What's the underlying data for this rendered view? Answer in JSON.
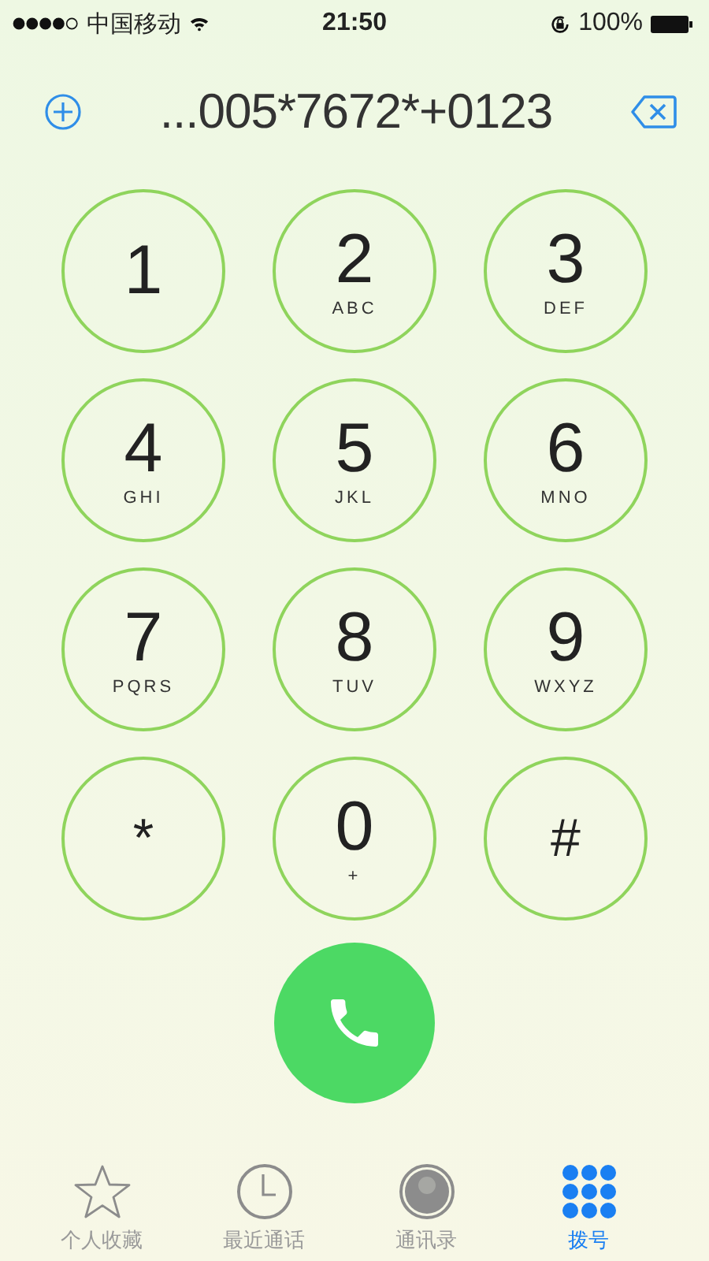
{
  "status_bar": {
    "carrier": "中国移动",
    "time": "21:50",
    "battery": "100%"
  },
  "dial": {
    "number": "...005*7672*+0123"
  },
  "keys": [
    {
      "digit": "1"
    },
    {
      "digit": "2",
      "letters": "ABC"
    },
    {
      "digit": "3",
      "letters": "DEF"
    },
    {
      "digit": "4",
      "letters": "GHI"
    },
    {
      "digit": "5",
      "letters": "JKL"
    },
    {
      "digit": "6",
      "letters": "MNO"
    },
    {
      "digit": "7",
      "letters": "PQRS"
    },
    {
      "digit": "8",
      "letters": "TUV"
    },
    {
      "digit": "9",
      "letters": "WXYZ"
    },
    {
      "digit": "*"
    },
    {
      "digit": "0",
      "letters": "+"
    },
    {
      "digit": "#"
    }
  ],
  "tabs": [
    {
      "kind": "star",
      "label": "个人收藏",
      "selected": false
    },
    {
      "kind": "clock",
      "label": "最近通话",
      "selected": false
    },
    {
      "kind": "contacts",
      "label": "通讯录",
      "selected": false
    },
    {
      "kind": "keypad",
      "label": "拨号",
      "selected": true
    }
  ]
}
